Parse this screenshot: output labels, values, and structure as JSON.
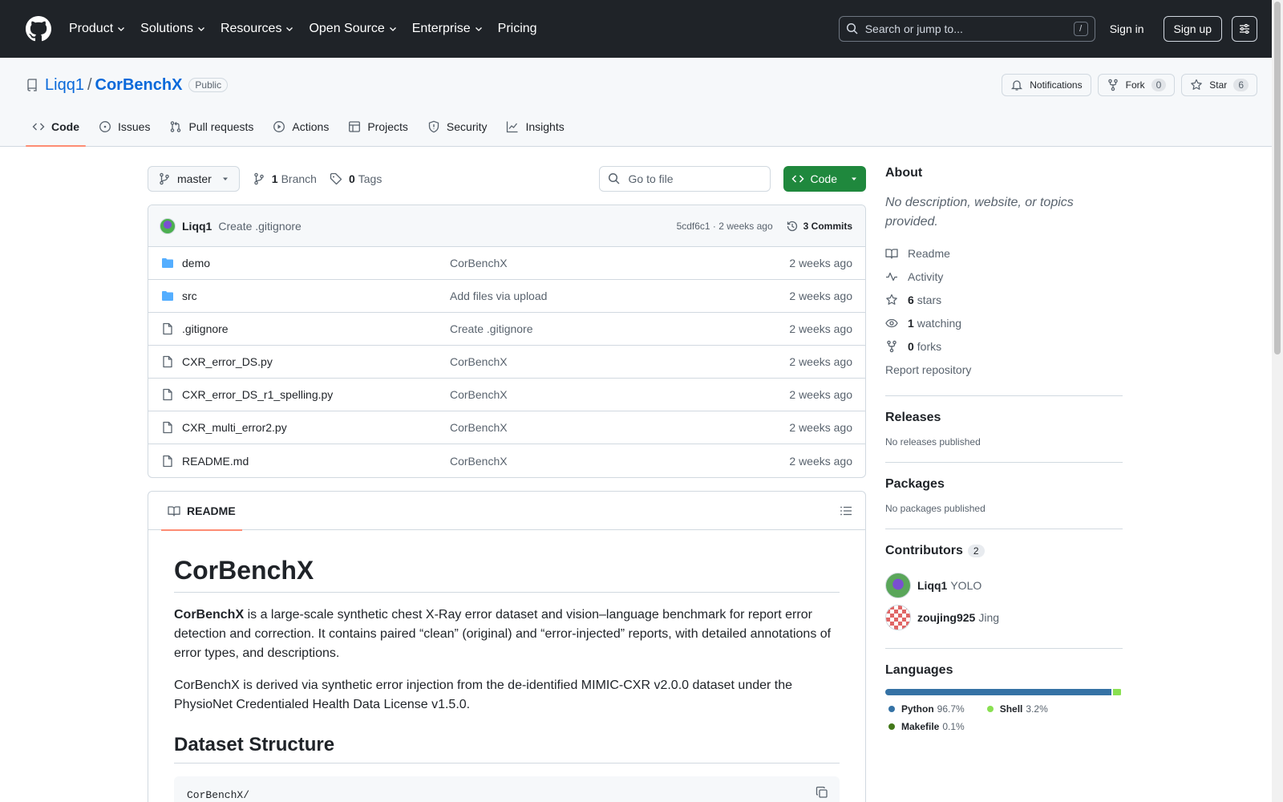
{
  "header": {
    "nav": [
      "Product",
      "Solutions",
      "Resources",
      "Open Source",
      "Enterprise",
      "Pricing"
    ],
    "search_placeholder": "Search or jump to...",
    "search_key": "/",
    "signin": "Sign in",
    "signup": "Sign up"
  },
  "repo": {
    "owner": "Liqq1",
    "separator": "/",
    "name": "CorBenchX",
    "visibility": "Public",
    "notifications": "Notifications",
    "fork_label": "Fork",
    "fork_count": "0",
    "star_label": "Star",
    "star_count": "6"
  },
  "tabs": [
    "Code",
    "Issues",
    "Pull requests",
    "Actions",
    "Projects",
    "Security",
    "Insights"
  ],
  "toolbar": {
    "branch": "master",
    "branch_count": "1",
    "branch_label": "Branch",
    "tag_count": "0",
    "tag_label": "Tags",
    "goto_placeholder": "Go to file",
    "code_label": "Code"
  },
  "commit": {
    "author": "Liqq1",
    "message": "Create .gitignore",
    "hash_time": "5cdf6c1 · 2 weeks ago",
    "commits": "3 Commits"
  },
  "files": [
    {
      "type": "dir",
      "name": "demo",
      "msg": "CorBenchX",
      "time": "2 weeks ago"
    },
    {
      "type": "dir",
      "name": "src",
      "msg": "Add files via upload",
      "time": "2 weeks ago"
    },
    {
      "type": "file",
      "name": ".gitignore",
      "msg": "Create .gitignore",
      "time": "2 weeks ago"
    },
    {
      "type": "file",
      "name": "CXR_error_DS.py",
      "msg": "CorBenchX",
      "time": "2 weeks ago"
    },
    {
      "type": "file",
      "name": "CXR_error_DS_r1_spelling.py",
      "msg": "CorBenchX",
      "time": "2 weeks ago"
    },
    {
      "type": "file",
      "name": "CXR_multi_error2.py",
      "msg": "CorBenchX",
      "time": "2 weeks ago"
    },
    {
      "type": "file",
      "name": "README.md",
      "msg": "CorBenchX",
      "time": "2 weeks ago"
    }
  ],
  "readme": {
    "tab": "README",
    "title": "CorBenchX",
    "p1_bold": "CorBenchX",
    "p1_rest": " is a large-scale synthetic chest X-Ray error dataset and vision–language benchmark for report error detection and correction. It contains paired “clean” (original) and “error-injected” reports, with detailed annotations of error types, and descriptions.",
    "p2": "CorBenchX is derived via synthetic error injection from the de-identified MIMIC-CXR v2.0.0 dataset under the PhysioNet Credentialed Health Data License v1.5.0.",
    "h2": "Dataset Structure",
    "code_line": "CorBenchX/"
  },
  "about": {
    "title": "About",
    "description": "No description, website, or topics provided.",
    "readme": "Readme",
    "activity": "Activity",
    "stars_count": "6",
    "stars_label": "stars",
    "watching_count": "1",
    "watching_label": "watching",
    "forks_count": "0",
    "forks_label": "forks",
    "report": "Report repository"
  },
  "releases": {
    "title": "Releases",
    "text": "No releases published"
  },
  "packages": {
    "title": "Packages",
    "text": "No packages published"
  },
  "contributors": {
    "title": "Contributors",
    "count": "2",
    "list": [
      {
        "login": "Liqq1",
        "name": "YOLO"
      },
      {
        "login": "zoujing925",
        "name": "Jing"
      }
    ]
  },
  "languages": {
    "title": "Languages",
    "list": [
      {
        "name": "Python",
        "pct": "96.7%",
        "value": 96.7,
        "color": "#3572A5"
      },
      {
        "name": "Shell",
        "pct": "3.2%",
        "value": 3.2,
        "color": "#89e051"
      },
      {
        "name": "Makefile",
        "pct": "0.1%",
        "value": 0.1,
        "color": "#427819"
      }
    ]
  }
}
